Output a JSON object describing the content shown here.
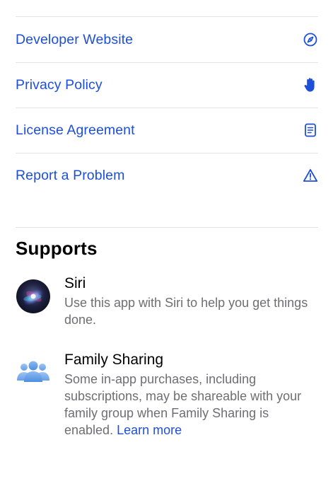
{
  "links": [
    {
      "label": "Developer Website",
      "icon": "compass-icon"
    },
    {
      "label": "Privacy Policy",
      "icon": "hand-icon"
    },
    {
      "label": "License Agreement",
      "icon": "document-icon"
    },
    {
      "label": "Report a Problem",
      "icon": "warning-icon"
    }
  ],
  "supports": {
    "title": "Supports",
    "items": [
      {
        "name": "Siri",
        "description": "Use this app with Siri to help you get things done.",
        "icon": "siri-icon"
      },
      {
        "name": "Family Sharing",
        "description": "Some in-app purchases, including subscriptions, may be shareable with your family group when Family Sharing is enabled.",
        "link": "Learn more",
        "icon": "family-sharing-icon"
      }
    ]
  },
  "colors": {
    "accent": "#1d4fd8",
    "secondary_text": "#6e6e73",
    "divider": "#e3e3e6"
  }
}
